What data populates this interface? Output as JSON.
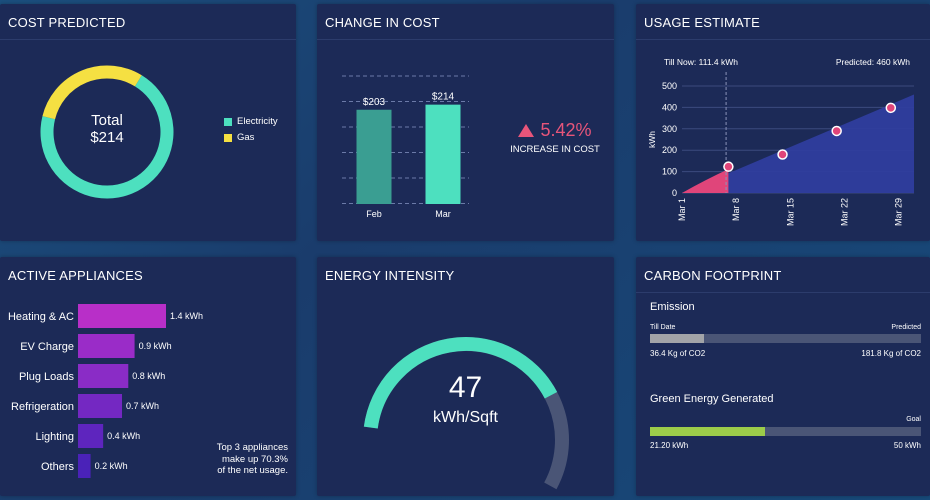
{
  "cost_predicted": {
    "title": "COST PREDICTED",
    "total_label": "Total",
    "total_value": "$214",
    "legend": [
      {
        "label": "Electricity",
        "color": "#4de0bf"
      },
      {
        "label": "Gas",
        "color": "#f5e042"
      }
    ]
  },
  "change_in_cost": {
    "title": "CHANGE IN COST",
    "percent": "5.42%",
    "caption": "INCREASE IN COST",
    "arrow_color": "#e8557a"
  },
  "usage_estimate": {
    "title": "USAGE ESTIMATE",
    "till_now": "Till Now: 111.4 kWh",
    "predicted": "Predicted: 460 kWh"
  },
  "active_appliances": {
    "title": "ACTIVE APPLIANCES",
    "note_line1": "Top 3 appliances",
    "note_line2": "make up 70.3%",
    "note_line3": "of the net usage."
  },
  "energy_intensity": {
    "title": "ENERGY INTENSITY",
    "value": "47",
    "unit": "kWh/Sqft",
    "fraction": 0.72,
    "fill_color": "#4de0bf",
    "track_color": "#4a5576"
  },
  "carbon_footprint": {
    "title": "CARBON FOOTPRINT",
    "emission": {
      "heading": "Emission",
      "left_label": "Till Date",
      "right_label": "Predicted",
      "left_value": "36.4 Kg of CO2",
      "right_value": "181.8 Kg of CO2",
      "fraction": 0.2,
      "fill_color": "#a2a4a8"
    },
    "green": {
      "heading": "Green Energy Generated",
      "right_label": "Goal",
      "left_value": "21.20 kWh",
      "right_value": "50 kWh",
      "fraction": 0.424,
      "fill_color": "#9ccc4a"
    }
  },
  "chart_data": [
    {
      "type": "pie",
      "categories": [
        "Electricity",
        "Gas"
      ],
      "values": [
        150,
        64
      ],
      "colors": [
        "#4de0bf",
        "#f5e042"
      ],
      "title": ""
    },
    {
      "type": "bar",
      "categories": [
        "Feb",
        "Mar"
      ],
      "values": [
        203,
        214
      ],
      "data_labels": [
        "$203",
        "$214"
      ],
      "colors": [
        "#3a9e92",
        "#4de0bf"
      ],
      "ylim": [
        0,
        280
      ]
    },
    {
      "type": "area",
      "x_ticks": [
        "Mar 1",
        "Mar 8",
        "Mar 15",
        "Mar 22",
        "Mar 29"
      ],
      "ylabel": "kWh",
      "ylim": [
        0,
        500
      ],
      "yticks": [
        0,
        100,
        200,
        300,
        400,
        500
      ],
      "xlim": [
        1,
        31
      ],
      "series": [
        {
          "name": "Till Now",
          "x": [
            1,
            7
          ],
          "y": [
            0,
            111.4
          ],
          "color": "#e0457a"
        },
        {
          "name": "Predicted",
          "x": [
            1,
            31
          ],
          "y": [
            0,
            460
          ],
          "color": "#2f3d9e"
        }
      ],
      "markers": {
        "x": [
          7,
          14,
          21,
          28
        ],
        "y": [
          123,
          180,
          290,
          398
        ],
        "color": "#e0457a"
      },
      "divider_x": 6.7
    },
    {
      "type": "bar",
      "orientation": "horizontal",
      "categories": [
        "Heating & AC",
        "EV Charge",
        "Plug Loads",
        "Refrigeration",
        "Lighting",
        "Others"
      ],
      "values": [
        1.4,
        0.9,
        0.8,
        0.7,
        0.4,
        0.2
      ],
      "data_labels": [
        "1.4 kWh",
        "0.9 kWh",
        "0.8 kWh",
        "0.7 kWh",
        "0.4 kWh",
        "0.2 kWh"
      ],
      "colors": [
        "#b82fc8",
        "#9a2cc8",
        "#8a2cc6",
        "#7428c2",
        "#5e25be",
        "#4a22b8"
      ],
      "xlim": [
        0,
        1.4
      ]
    }
  ]
}
